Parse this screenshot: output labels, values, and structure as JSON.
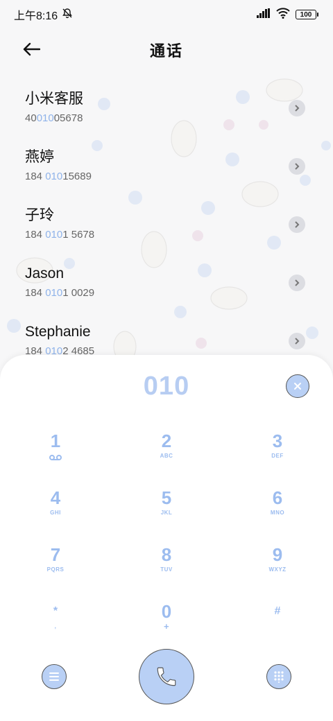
{
  "status_bar": {
    "time": "上午8:16",
    "battery": "100"
  },
  "header": {
    "title": "通话"
  },
  "contacts": [
    {
      "name": "小米客服",
      "number_prefix": "40",
      "number_match": "010",
      "number_suffix": "05678"
    },
    {
      "name": "燕婷",
      "number_prefix": "184 ",
      "number_match": "010",
      "number_suffix": "15689"
    },
    {
      "name": "子玲",
      "number_prefix": "184 ",
      "number_match": "010",
      "number_suffix": "1 5678"
    },
    {
      "name": "Jason",
      "number_prefix": "184 ",
      "number_match": "010",
      "number_suffix": "1 0029"
    },
    {
      "name": "Stephanie",
      "number_prefix": "184 ",
      "number_match": "010",
      "number_suffix": "2 4685"
    }
  ],
  "dialpad": {
    "display": "010",
    "keys": [
      {
        "digit": "1",
        "sub": "voicemail"
      },
      {
        "digit": "2",
        "sub": "ABC"
      },
      {
        "digit": "3",
        "sub": "DEF"
      },
      {
        "digit": "4",
        "sub": "GHI"
      },
      {
        "digit": "5",
        "sub": "JKL"
      },
      {
        "digit": "6",
        "sub": "MNO"
      },
      {
        "digit": "7",
        "sub": "PQRS"
      },
      {
        "digit": "8",
        "sub": "TUV"
      },
      {
        "digit": "9",
        "sub": "WXYZ"
      },
      {
        "digit": "*",
        "sub": ","
      },
      {
        "digit": "0",
        "sub": "+"
      },
      {
        "digit": "#",
        "sub": ""
      }
    ]
  },
  "icons": {
    "back": "back-arrow-icon",
    "clear": "clear-icon",
    "menu": "menu-icon",
    "call": "phone-icon",
    "keypad": "keypad-icon",
    "detail": "chevron-right-icon"
  },
  "colors": {
    "accent": "#9cbcef",
    "button_fill": "#b9d0f5",
    "highlight": "#8fb3ea"
  }
}
